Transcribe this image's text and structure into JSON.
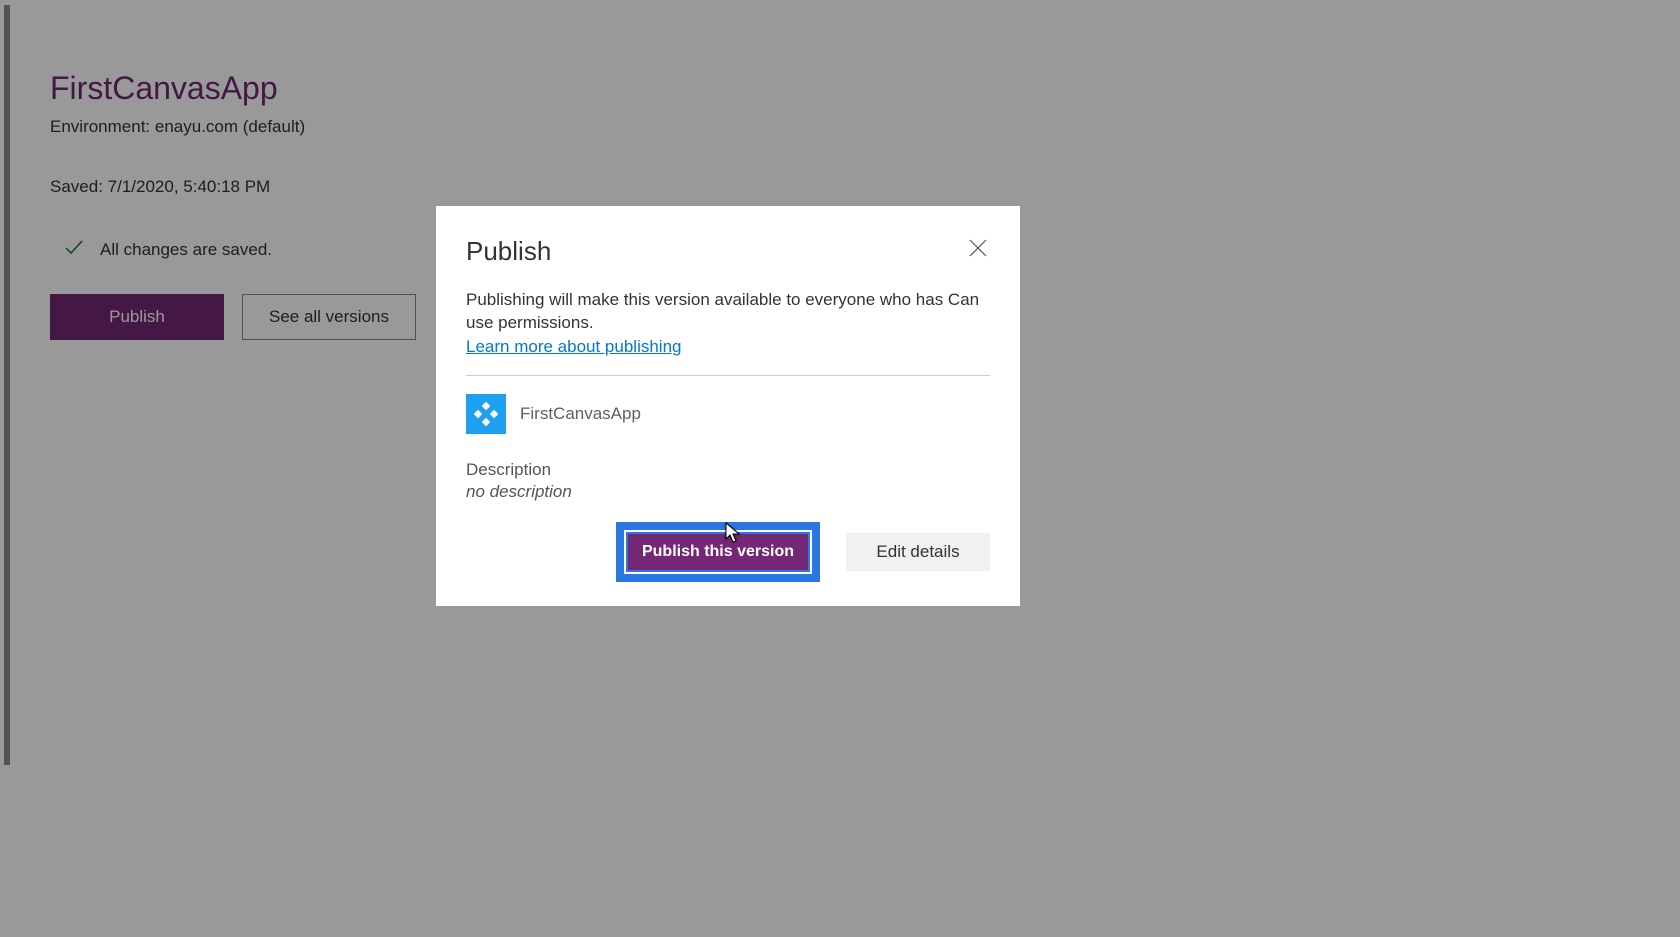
{
  "page": {
    "app_title": "FirstCanvasApp",
    "environment_label": "Environment: enayu.com (default)",
    "saved_label": "Saved: 7/1/2020, 5:40:18 PM",
    "status_text": "All changes are saved.",
    "buttons": {
      "publish": "Publish",
      "see_all_versions": "See all versions"
    }
  },
  "modal": {
    "title": "Publish",
    "description": "Publishing will make this version available to everyone who has Can use permissions.",
    "learn_more": "Learn more about publishing",
    "app_name": "FirstCanvasApp",
    "desc_label": "Description",
    "desc_value": "no description",
    "buttons": {
      "publish_this_version": "Publish this version",
      "edit_details": "Edit details"
    }
  },
  "colors": {
    "accent": "#742774",
    "link": "#0078d4",
    "highlight": "#2b77e2",
    "app_icon_bg": "#1ea0f0"
  }
}
